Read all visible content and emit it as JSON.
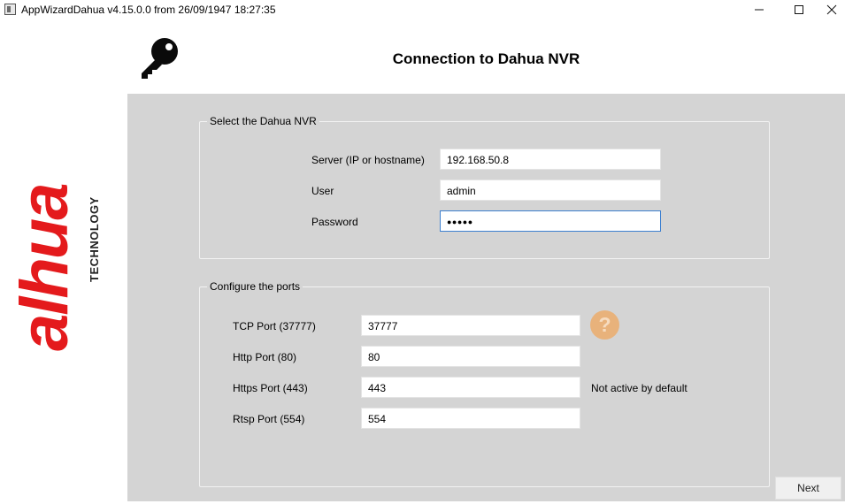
{
  "window": {
    "title": "AppWizardDahua v4.15.0.0 from 26/09/1947 18:27:35",
    "minimize_glyph": "—",
    "maximize_glyph": "☐",
    "close_glyph": "✕"
  },
  "brand": {
    "name": "alhua",
    "tagline": "TECHNOLOGY",
    "color": "#e41a1c"
  },
  "header": {
    "icon": "key-icon",
    "title": "Connection to Dahua NVR"
  },
  "nvr_group": {
    "legend": "Select the Dahua NVR",
    "server_label": "Server (IP or hostname)",
    "server_value": "192.168.50.8",
    "user_label": "User",
    "user_value": "admin",
    "password_label": "Password",
    "password_value": "●●●●●"
  },
  "ports_group": {
    "legend": "Configure the ports",
    "tcp_label": "TCP Port (37777)",
    "tcp_value": "37777",
    "http_label": "Http Port (80)",
    "http_value": "80",
    "https_label": "Https Port (443)",
    "https_value": "443",
    "https_note": "Not active by default",
    "rtsp_label": "Rtsp Port (554)",
    "rtsp_value": "554",
    "help_icon": "help-icon",
    "help_glyph": "?"
  },
  "footer": {
    "next_label": "Next"
  },
  "colors": {
    "content_bg": "#d4d4d4",
    "focus_border": "#3c7fcf",
    "help_icon": "#e8b27b"
  }
}
